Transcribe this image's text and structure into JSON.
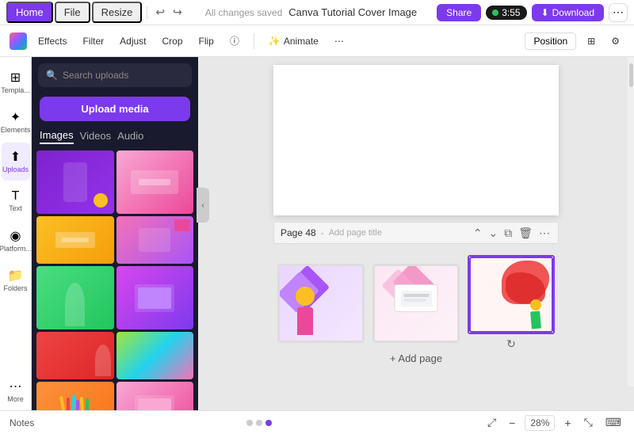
{
  "topbar": {
    "tabs": [
      "Home",
      "File",
      "Resize"
    ],
    "active_tab": "Home",
    "undo_label": "↩",
    "redo_label": "↪",
    "saved_text": "All changes saved",
    "title": "Canva Tutorial Cover Image",
    "share_label": "Share",
    "timer": "3:55",
    "download_label": "Download",
    "more_icon": "⋯"
  },
  "toolbar2": {
    "effects_label": "Effects",
    "filter_label": "Filter",
    "adjust_label": "Adjust",
    "crop_label": "Crop",
    "flip_label": "Flip",
    "info_icon": "ⓘ",
    "animate_label": "Animate",
    "more_icon": "⋯",
    "position_label": "Position",
    "grid_icon": "⊞"
  },
  "sidebar": {
    "items": [
      {
        "id": "templates",
        "label": "Templa...",
        "icon": "⊞"
      },
      {
        "id": "elements",
        "label": "Elements",
        "icon": "✦"
      },
      {
        "id": "uploads",
        "label": "Uploads",
        "icon": "⬆"
      },
      {
        "id": "text",
        "label": "Text",
        "icon": "T"
      },
      {
        "id": "brand",
        "label": "Platform...",
        "icon": "◉"
      },
      {
        "id": "more",
        "label": "More",
        "icon": "⋯"
      },
      {
        "id": "folders",
        "label": "Folders",
        "icon": "📁"
      }
    ],
    "active": "uploads"
  },
  "upload_panel": {
    "search_placeholder": "Search uploads",
    "upload_btn": "Upload media",
    "tabs": [
      "Images",
      "Videos",
      "Audio"
    ],
    "active_tab": "Images",
    "images": [
      {
        "id": 1,
        "color1": "#9333ea",
        "color2": "#c084fc",
        "type": "person-purple"
      },
      {
        "id": 2,
        "color1": "#f9a8d4",
        "color2": "#ec4899",
        "type": "desk-pink"
      },
      {
        "id": 3,
        "color1": "#fbbf24",
        "color2": "#f59e0b",
        "type": "yellow-solid"
      },
      {
        "id": 4,
        "color1": "#f472b6",
        "color2": "#db2777",
        "type": "tech-pink"
      },
      {
        "id": 5,
        "color1": "#22c55e",
        "color2": "#16a34a",
        "type": "person-green"
      },
      {
        "id": 6,
        "color1": "#ec4899",
        "color2": "#9333ea",
        "type": "laptop-purple"
      },
      {
        "id": 7,
        "color1": "#ef4444",
        "color2": "#dc2626",
        "type": "red-solid"
      },
      {
        "id": 8,
        "color1": "#22d3ee",
        "color2": "#06b6d4",
        "type": "colorful"
      },
      {
        "id": 9,
        "color1": "#f97316",
        "color2": "#ea580c",
        "type": "pencils"
      },
      {
        "id": 10,
        "color1": "#ec4899",
        "color2": "#db2777",
        "type": "laptop-pink"
      },
      {
        "id": 11,
        "color1": "#fbbf24",
        "color2": "#f59e0b",
        "type": "yellow2"
      },
      {
        "id": 12,
        "color1": "#a855f7",
        "color2": "#9333ea",
        "type": "purple2"
      }
    ]
  },
  "canvas": {
    "page_label": "Page 48",
    "add_title_placeholder": "Add page title",
    "add_page_btn": "+ Add page",
    "thumbnails": [
      {
        "id": 1,
        "selected": false,
        "bg_color": "#a855f7"
      },
      {
        "id": 2,
        "selected": false,
        "bg_color": "#f9a8d4"
      },
      {
        "id": 3,
        "selected": true,
        "bg_color": "#ef4444"
      }
    ]
  },
  "bottom_bar": {
    "notes_label": "Notes",
    "zoom_level": "28%",
    "expand_icon": "⤢",
    "zoom_in_icon": "+",
    "zoom_out_icon": "−"
  }
}
